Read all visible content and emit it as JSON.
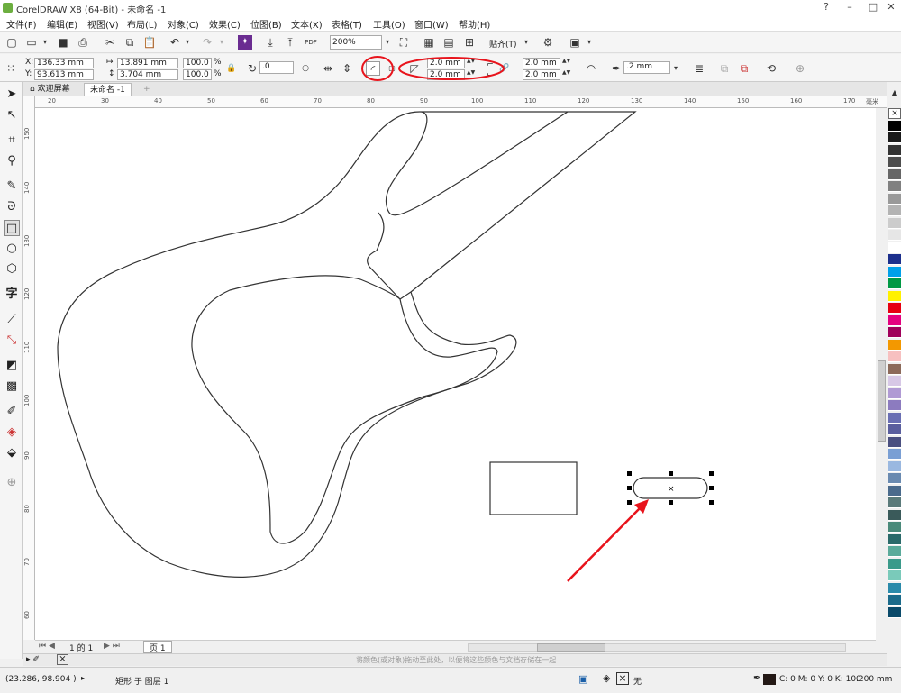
{
  "window": {
    "title": "CorelDRAW X8 (64-Bit) - 未命名 -1",
    "controls": [
      "?",
      "–",
      "□",
      "✕"
    ]
  },
  "menu": [
    "文件(F)",
    "编辑(E)",
    "视图(V)",
    "布局(L)",
    "对象(C)",
    "效果(C)",
    "位图(B)",
    "文本(X)",
    "表格(T)",
    "工具(O)",
    "窗口(W)",
    "帮助(H)"
  ],
  "standard_toolbar": {
    "zoom_value": "200%",
    "snap_label": "贴齐(T)"
  },
  "property_bar": {
    "x_label": "X:",
    "x_value": "136.33 mm",
    "y_label": "Y:",
    "y_value": "93.613 mm",
    "width_value": "13.891 mm",
    "height_value": "3.704 mm",
    "scale_w": "100.0",
    "scale_h": "100.0",
    "percent": "%",
    "rotation_value": ".0",
    "corner_tl": "2.0 mm",
    "corner_bl": "2.0 mm",
    "corner_tr": "2.0 mm",
    "corner_br": "2.0 mm",
    "outline_width": ".2 mm"
  },
  "doc_tabs": [
    {
      "label": "欢迎屏幕",
      "active": false
    },
    {
      "label": "未命名 -1",
      "active": true
    }
  ],
  "ruler": {
    "h_labels": [
      "20",
      "30",
      "40",
      "50",
      "60",
      "70",
      "80",
      "90",
      "100",
      "110",
      "120",
      "130",
      "140",
      "150",
      "160",
      "170"
    ],
    "h_unit": "毫米",
    "v_labels": [
      "150",
      "140",
      "130",
      "120",
      "110",
      "100",
      "90",
      "80",
      "70",
      "60"
    ]
  },
  "page_nav": {
    "page_info": "1 的 1",
    "page_tab": "页 1"
  },
  "hint_text": "将颜色(或对象)拖动至此处，以便将这些颜色与文档存储在一起",
  "status": {
    "coords": "(23.286, 98.904 )",
    "object_info": "矩形 于 图层 1",
    "fill_label": "无",
    "outline_color": "C: 0 M: 0 Y: 0 K: 100",
    "outline_width": ".200 mm"
  },
  "colors": {
    "annotation_red": "#e8141c",
    "selection_black": "#000000",
    "palette": [
      "#ffffff",
      "#000000",
      "#1a1a1a",
      "#333333",
      "#4d4d4d",
      "#666666",
      "#808080",
      "#999999",
      "#b3b3b3",
      "#cccccc",
      "#e6e6e6",
      "#ffffff",
      "#1c2f8c",
      "#00a0e9",
      "#009944",
      "#fff100",
      "#e60012",
      "#e4007f",
      "#a0005a",
      "#f39800",
      "#f7c0c0",
      "#8c6a5a",
      "#d7c8e6",
      "#b09ad4",
      "#8c7bbf",
      "#6a6fb3",
      "#5a5e9e",
      "#4a4f80",
      "#7a9fd4",
      "#9ab8e0",
      "#6a8ab0",
      "#4a6a8c",
      "#5a7a7a",
      "#3a5a5a",
      "#4a8a7a",
      "#2a6a6a",
      "#5aaa9a",
      "#3a9a8a",
      "#7acaba",
      "#2a8aaa",
      "#1a6a8a",
      "#0a4a6a"
    ]
  }
}
